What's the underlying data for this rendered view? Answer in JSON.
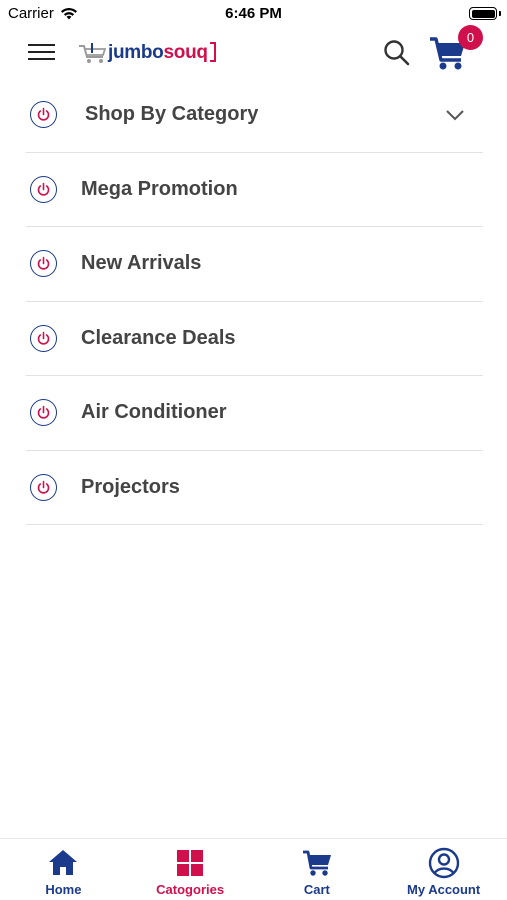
{
  "status_bar": {
    "carrier": "Carrier",
    "time": "6:46 PM"
  },
  "header": {
    "logo_part1": "jumbo",
    "logo_part2": "souq",
    "cart_count": "0"
  },
  "colors": {
    "brand_blue": "#1b3a8c",
    "brand_pink": "#d0104c",
    "text": "#444444"
  },
  "menu": {
    "items": [
      {
        "label": "Shop By Category",
        "icon": "power-icon",
        "expandable": true
      },
      {
        "label": "Mega Promotion",
        "icon": "power-icon"
      },
      {
        "label": "New Arrivals",
        "icon": "power-icon"
      },
      {
        "label": "Clearance Deals",
        "icon": "power-icon"
      },
      {
        "label": "Air Conditioner",
        "icon": "power-icon"
      },
      {
        "label": "Projectors",
        "icon": "power-icon"
      }
    ]
  },
  "tabs": [
    {
      "label": "Home",
      "icon": "home-icon",
      "active": false
    },
    {
      "label": "Catogories",
      "icon": "grid-icon",
      "active": true
    },
    {
      "label": "Cart",
      "icon": "cart-icon",
      "active": false
    },
    {
      "label": "My Account",
      "icon": "account-icon",
      "active": false
    }
  ]
}
